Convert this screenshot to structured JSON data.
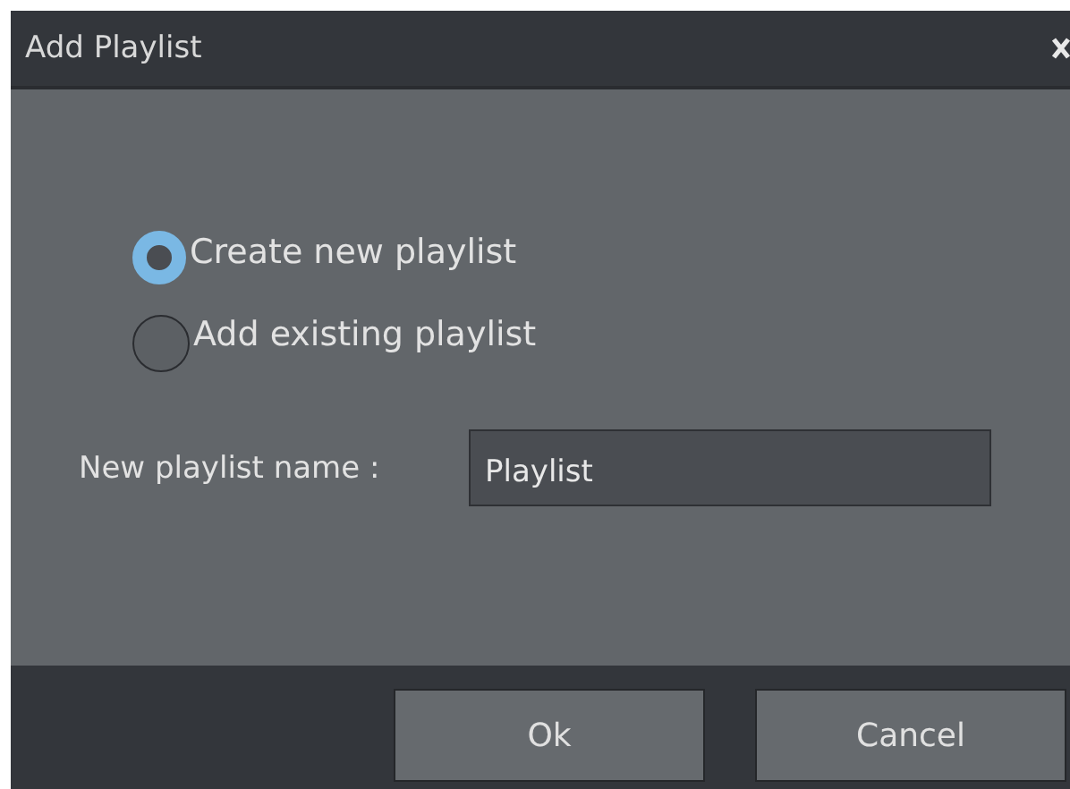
{
  "window": {
    "title": "Add Playlist"
  },
  "options": [
    {
      "label": "Create new playlist",
      "selected": true
    },
    {
      "label": "Add existing playlist",
      "selected": false
    }
  ],
  "name_field": {
    "label": "New playlist name :",
    "value": "Playlist"
  },
  "buttons": [
    "Ok",
    "Cancel"
  ]
}
